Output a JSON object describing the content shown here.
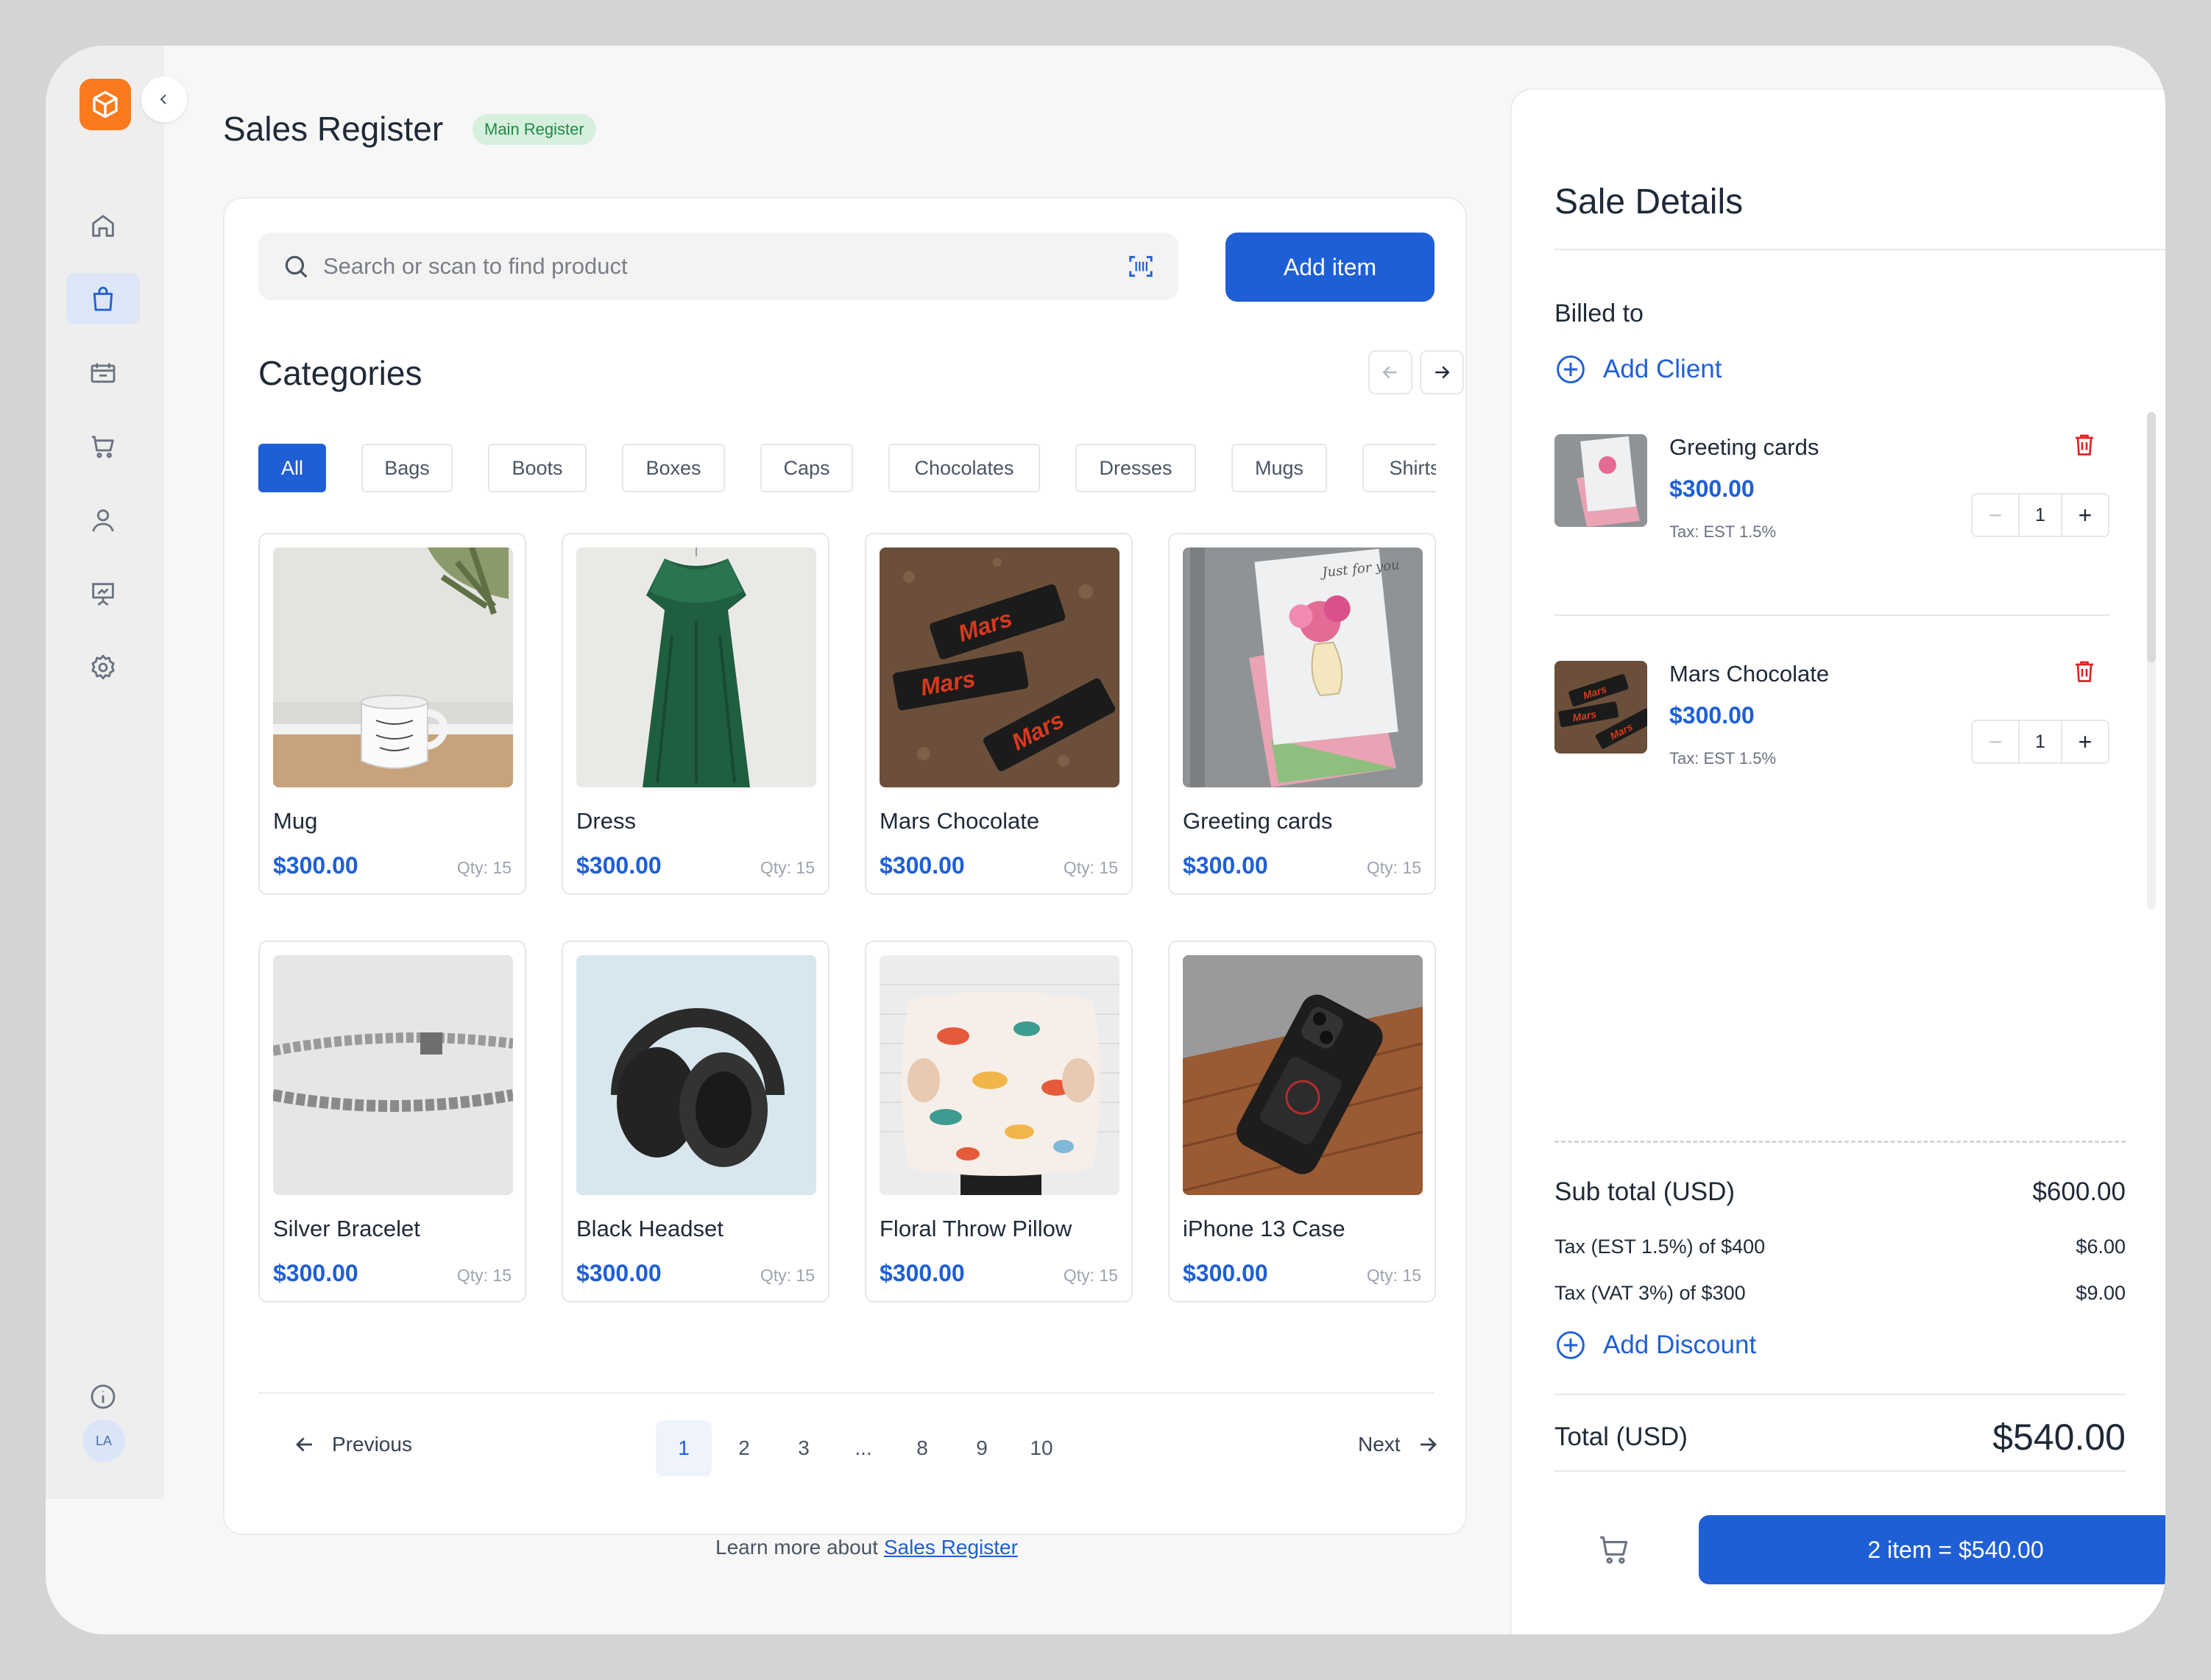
{
  "header": {
    "title": "Sales Register",
    "badge": "Main Register"
  },
  "sidebar": {
    "items": [
      {
        "icon": "home-icon"
      },
      {
        "icon": "shopping-bag-icon",
        "active": true
      },
      {
        "icon": "ticket-icon"
      },
      {
        "icon": "cart-icon"
      },
      {
        "icon": "user-icon"
      },
      {
        "icon": "presentation-icon"
      },
      {
        "icon": "gear-icon"
      }
    ],
    "avatar_initials": "LA"
  },
  "search": {
    "placeholder": "Search or scan to find product"
  },
  "toolbar": {
    "add_item_label": "Add item"
  },
  "categories": {
    "title": "Categories",
    "chips": [
      "All",
      "Bags",
      "Boots",
      "Boxes",
      "Caps",
      "Chocolates",
      "Dresses",
      "Mugs",
      "Shirts"
    ]
  },
  "products": [
    {
      "name": "Mug",
      "price": "$300.00",
      "qty": "Qty: 15"
    },
    {
      "name": "Dress",
      "price": "$300.00",
      "qty": "Qty: 15"
    },
    {
      "name": "Mars Chocolate",
      "price": "$300.00",
      "qty": "Qty: 15"
    },
    {
      "name": "Greeting cards",
      "price": "$300.00",
      "qty": "Qty: 15"
    },
    {
      "name": "Silver Bracelet",
      "price": "$300.00",
      "qty": "Qty: 15"
    },
    {
      "name": "Black Headset",
      "price": "$300.00",
      "qty": "Qty: 15"
    },
    {
      "name": "Floral Throw Pillow",
      "price": "$300.00",
      "qty": "Qty: 15"
    },
    {
      "name": "iPhone 13 Case",
      "price": "$300.00",
      "qty": "Qty: 15"
    }
  ],
  "pagination": {
    "previous": "Previous",
    "next": "Next",
    "pages": [
      "1",
      "2",
      "3",
      "...",
      "8",
      "9",
      "10"
    ],
    "current": "1"
  },
  "footer": {
    "learn_text": "Learn more about",
    "learn_link": "Sales Register"
  },
  "sale": {
    "title": "Sale Details",
    "billed_to": "Billed to",
    "add_client": "Add Client",
    "items": [
      {
        "name": "Greeting cards",
        "price": "$300.00",
        "tax": "Tax: EST 1.5%",
        "qty": "1"
      },
      {
        "name": "Mars Chocolate",
        "price": "$300.00",
        "tax": "Tax: EST 1.5%",
        "qty": "1"
      }
    ],
    "subtotal_label": "Sub total (USD)",
    "subtotal_value": "$600.00",
    "tax1_label": "Tax (EST 1.5%) of $400",
    "tax1_value": "$6.00",
    "tax2_label": "Tax (VAT 3%) of $300",
    "tax2_value": "$9.00",
    "add_discount": "Add Discount",
    "total_label": "Total (USD)",
    "total_value": "$540.00",
    "checkout_label": "2 item = $540.00"
  },
  "colors": {
    "accent": "#1f5fd6",
    "brand": "#fb7a1e",
    "danger": "#e02424",
    "badge_bg": "#d7f0de"
  }
}
